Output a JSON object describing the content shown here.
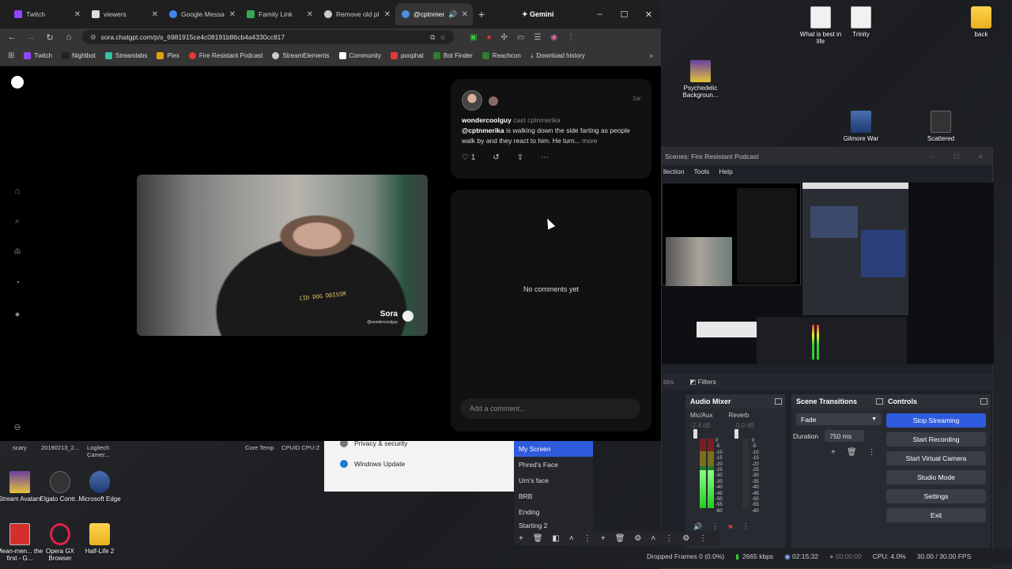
{
  "browser": {
    "tabs": [
      {
        "label": "Twitch",
        "color": "#9146ff"
      },
      {
        "label": "viewers",
        "color": "#ffffff"
      },
      {
        "label": "Google Messa",
        "color": "#4285f4"
      },
      {
        "label": "Family Link",
        "color": "#34a853"
      },
      {
        "label": "Remove old pl",
        "color": "#dddddd"
      },
      {
        "label": "@cptnmer",
        "color": "#4a90e2"
      }
    ],
    "new_tab": "+",
    "gemini": "✦ Gemini",
    "url": "sora.chatgpt.com/p/s_6981915ce4c08191b86cb4a4330cc817",
    "bookmarks": [
      {
        "label": "Twitch",
        "color": "#9146ff"
      },
      {
        "label": "Nightbot",
        "color": "#222222"
      },
      {
        "label": "Streamlabs",
        "color": "#31c3a2"
      },
      {
        "label": "Plex",
        "color": "#e5a00d"
      },
      {
        "label": "Fire Resistant Podcast",
        "color": "#e53935"
      },
      {
        "label": "StreamElements",
        "color": "#cccccc"
      },
      {
        "label": "Community",
        "color": "#ffffff"
      },
      {
        "label": "poophat",
        "color": "#e53935"
      },
      {
        "label": "Bot Finder",
        "color": "#2e7d32"
      },
      {
        "label": "Reachcon",
        "color": "#2e7d32"
      },
      {
        "label": "Download history",
        "color": "#bbbbbb"
      }
    ]
  },
  "post": {
    "time_ago": "1w",
    "username": "wondercoolguy",
    "cast_label": "cast cptnmerika",
    "mention": "@cptnmerika",
    "text": " is walking down the side farting as people walk by and they react to him. He turn...",
    "more": "more",
    "likes": "1",
    "watermark": "Sora",
    "watermark_handle": "@wondercoolguy",
    "shirt_text": "CID DOG DDISSM"
  },
  "comments": {
    "empty": "No comments yet",
    "placeholder": "Add a comment..."
  },
  "desktop": {
    "icons": [
      {
        "label": "What is best in life"
      },
      {
        "label": "Trinity"
      },
      {
        "label": "back"
      },
      {
        "label": "Psychedelic Backgroun..."
      },
      {
        "label": "Gilmore War"
      },
      {
        "label": "Scattered"
      },
      {
        "label": "Stream Avatars"
      },
      {
        "label": "Elgato Contr..."
      },
      {
        "label": "Microsoft Edge"
      },
      {
        "label": "Mean-men... the first - G..."
      },
      {
        "label": "Opera GX Browser"
      },
      {
        "label": "Half-Life 2"
      }
    ],
    "taskbar_labels": [
      "scary",
      "20190213_2...",
      "Logitech Camer...",
      "Core Temp",
      "CPUID CPU-Z"
    ]
  },
  "settings_window": {
    "row1": "Privacy & security",
    "row2": "Windows Update"
  },
  "obs": {
    "title": "Scenes: Fire Resistant Podcast",
    "menu": [
      "llection",
      "Tools",
      "Help"
    ],
    "filters_tab": "ties",
    "filters": "Filters",
    "audio_mixer": {
      "title": "Audio Mixer",
      "channels": [
        {
          "name": "Mic/Aux",
          "db": "-2.4 dB"
        },
        {
          "name": "Reverb",
          "db": "0.0 dB"
        }
      ],
      "ticks": [
        "0",
        "-5",
        "-10",
        "-15",
        "-20",
        "-25",
        "-30",
        "-35",
        "-40",
        "-45",
        "-50",
        "-55",
        "-60"
      ],
      "level_mic": 0.55
    },
    "transitions": {
      "title": "Scene Transitions",
      "selected": "Fade",
      "duration_label": "Duration",
      "duration_value": "750 ms"
    },
    "controls": {
      "title": "Controls",
      "buttons": [
        "Stop Streaming",
        "Start Recording",
        "Start Virtual Camera",
        "Studio Mode",
        "Settings",
        "Exit"
      ]
    },
    "scenes": [
      "My Screen",
      "Phred's Face",
      "Urn's face",
      "BRB",
      "Ending",
      "Starting 2"
    ],
    "status": {
      "dropped": "Dropped Frames 0 (0.0%)",
      "bitrate": "2665 kbps",
      "stream_time": "02:15:32",
      "rec_time": "00:00:00",
      "cpu": "CPU: 4.0%",
      "fps": "30.00 / 30.00 FPS"
    }
  }
}
